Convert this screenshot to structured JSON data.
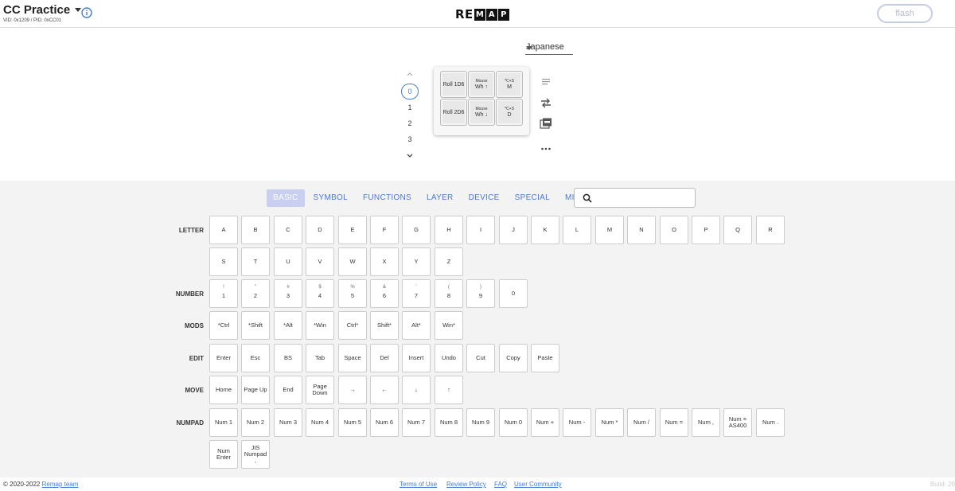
{
  "header": {
    "title": "CC Practice",
    "vid_pid": "VID: 0x1209 / PID: 0xCC01",
    "logo_plain": "RE",
    "logo_boxed": [
      "M",
      "A",
      "P"
    ],
    "flash_label": "flash"
  },
  "keyboard": {
    "language": "Japanese",
    "layers": [
      "0",
      "1",
      "2",
      "3"
    ],
    "selected_layer": "0",
    "keys": [
      {
        "l1": "",
        "l2": "Roll 1D6"
      },
      {
        "l1": "Mouse",
        "l2": "Wh ↑"
      },
      {
        "l1": "*C+S",
        "l2": "M"
      },
      {
        "l1": "",
        "l2": "Roll 2D6"
      },
      {
        "l1": "Mouse",
        "l2": "Wh ↓"
      },
      {
        "l1": "*C+S",
        "l2": "D"
      }
    ]
  },
  "palette": {
    "tabs": [
      "BASIC",
      "SYMBOL",
      "FUNCTIONS",
      "LAYER",
      "DEVICE",
      "SPECIAL",
      "MIDI"
    ],
    "active_tab": "BASIC",
    "search_placeholder": "",
    "rows": [
      {
        "label": "LETTER",
        "keys": [
          {
            "t": "A"
          },
          {
            "t": "B"
          },
          {
            "t": "C"
          },
          {
            "t": "D"
          },
          {
            "t": "E"
          },
          {
            "t": "F"
          },
          {
            "t": "G"
          },
          {
            "t": "H"
          },
          {
            "t": "I"
          },
          {
            "t": "J"
          },
          {
            "t": "K"
          },
          {
            "t": "L"
          },
          {
            "t": "M"
          },
          {
            "t": "N"
          },
          {
            "t": "O"
          },
          {
            "t": "P"
          },
          {
            "t": "Q"
          },
          {
            "t": "R"
          }
        ]
      },
      {
        "label": "",
        "keys": [
          {
            "t": "S"
          },
          {
            "t": "T"
          },
          {
            "t": "U"
          },
          {
            "t": "V"
          },
          {
            "t": "W"
          },
          {
            "t": "X"
          },
          {
            "t": "Y"
          },
          {
            "t": "Z"
          }
        ]
      },
      {
        "label": "NUMBER",
        "keys": [
          {
            "s": "!",
            "t": "1"
          },
          {
            "s": "\"",
            "t": "2"
          },
          {
            "s": "#",
            "t": "3"
          },
          {
            "s": "$",
            "t": "4"
          },
          {
            "s": "%",
            "t": "5"
          },
          {
            "s": "&",
            "t": "6"
          },
          {
            "s": "'",
            "t": "7"
          },
          {
            "s": "(",
            "t": "8"
          },
          {
            "s": ")",
            "t": "9"
          },
          {
            "t": "0"
          }
        ]
      },
      {
        "label": "MODS",
        "keys": [
          {
            "t": "*Ctrl"
          },
          {
            "t": "*Shift"
          },
          {
            "t": "*Alt"
          },
          {
            "t": "*Win"
          },
          {
            "t": "Ctrl*"
          },
          {
            "t": "Shift*"
          },
          {
            "t": "Alt*"
          },
          {
            "t": "Win*"
          }
        ]
      },
      {
        "label": "EDIT",
        "keys": [
          {
            "t": "Enter"
          },
          {
            "t": "Esc"
          },
          {
            "t": "BS"
          },
          {
            "t": "Tab"
          },
          {
            "t": "Space"
          },
          {
            "t": "Del"
          },
          {
            "t": "Insert"
          },
          {
            "t": "Undo"
          },
          {
            "t": "Cut"
          },
          {
            "t": "Copy"
          },
          {
            "t": "Paste"
          }
        ]
      },
      {
        "label": "MOVE",
        "keys": [
          {
            "t": "Home"
          },
          {
            "t": "Page Up"
          },
          {
            "t": "End"
          },
          {
            "t": "Page\nDown"
          },
          {
            "t": "→"
          },
          {
            "t": "←"
          },
          {
            "t": "↓"
          },
          {
            "t": "↑"
          }
        ]
      },
      {
        "label": "NUMPAD",
        "keys": [
          {
            "t": "Num 1"
          },
          {
            "t": "Num 2"
          },
          {
            "t": "Num 3"
          },
          {
            "t": "Num 4"
          },
          {
            "t": "Num 5"
          },
          {
            "t": "Num 6"
          },
          {
            "t": "Num 7"
          },
          {
            "t": "Num 8"
          },
          {
            "t": "Num 9"
          },
          {
            "t": "Num 0"
          },
          {
            "t": "Num +"
          },
          {
            "t": "Num -"
          },
          {
            "t": "Num *"
          },
          {
            "t": "Num /"
          },
          {
            "t": "Num ="
          },
          {
            "t": "Num ,"
          },
          {
            "t": "Num =\nAS400"
          },
          {
            "t": "Num ."
          }
        ]
      },
      {
        "label": "",
        "keys": [
          {
            "t": "Num\nEnter"
          },
          {
            "t": "JIS\nNumpad\n,"
          }
        ]
      }
    ]
  },
  "footer": {
    "copyright": "© 2020-2022",
    "team_link": "Remap team",
    "links": [
      "Terms of Use",
      "Review Policy",
      "FAQ",
      "User Community"
    ],
    "build": "Build: 20"
  }
}
